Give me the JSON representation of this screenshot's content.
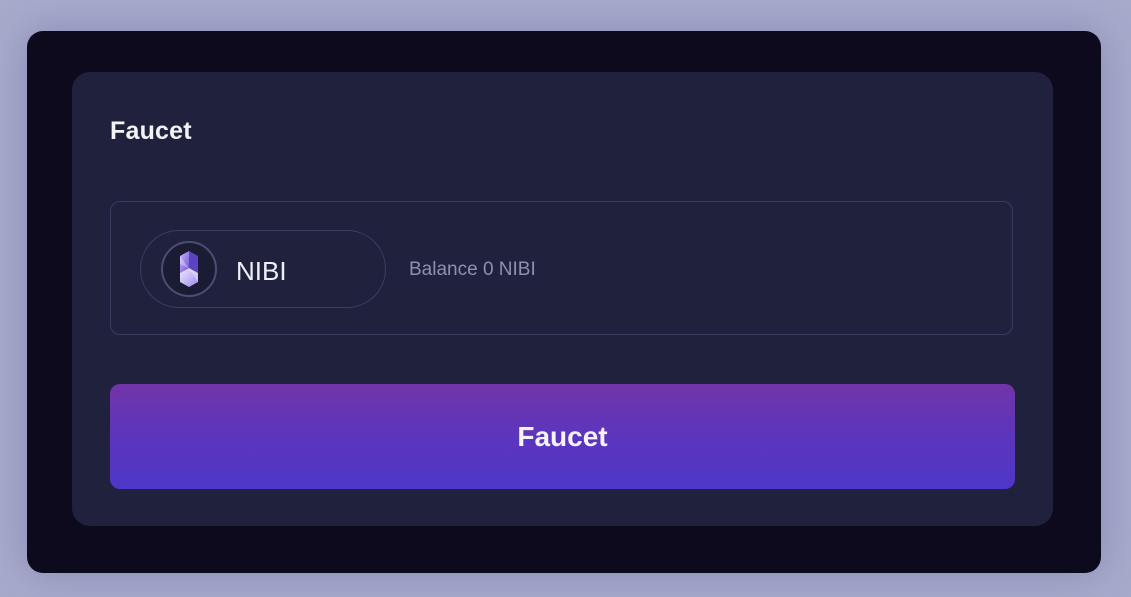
{
  "card": {
    "title": "Faucet"
  },
  "token": {
    "symbol": "NIBI",
    "icon": "nibiru-logo-icon",
    "balance_text": "Balance 0 NIBI"
  },
  "actions": {
    "faucet_label": "Faucet"
  },
  "colors": {
    "page_background": "#a7aacb",
    "frame_background": "#0d0a1d",
    "card_background": "#20223d",
    "button_gradient_top": "#7135a8",
    "button_gradient_bottom": "#4d36c8"
  }
}
